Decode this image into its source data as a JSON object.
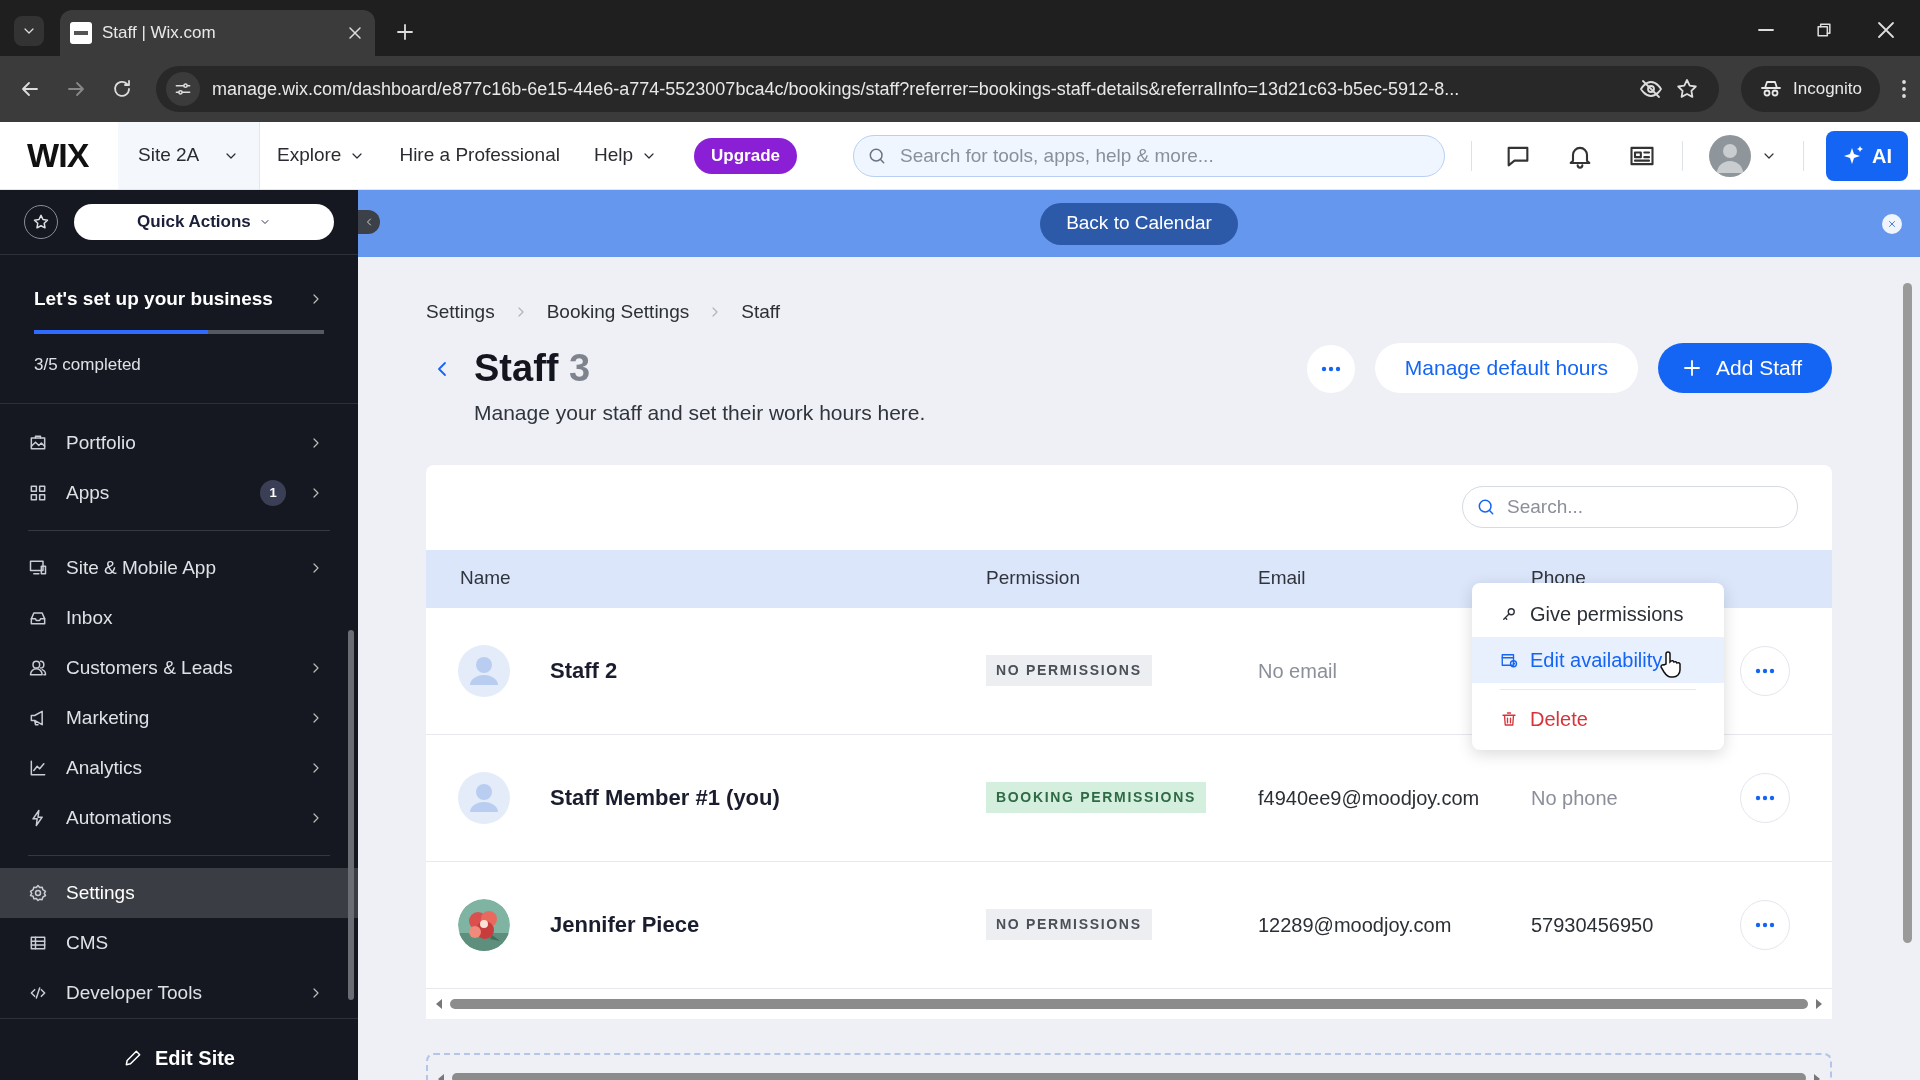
{
  "browser": {
    "tab_title": "Staff | Wix.com",
    "url": "manage.wix.com/dashboard/e877c16b-6e15-44e6-a774-5523007bca4c/bookings/staff?referrer=bookings-staff-details&referralInfo=13d21c63-b5ec-5912-8...",
    "profile": "Incognito"
  },
  "header": {
    "logo": "WIX",
    "site": "Site 2A",
    "nav": [
      {
        "label": "Explore",
        "dropdown": true
      },
      {
        "label": "Hire a Professional",
        "dropdown": false
      },
      {
        "label": "Help",
        "dropdown": true
      }
    ],
    "upgrade": "Upgrade",
    "search": {
      "placeholder": "Search for tools, apps, help & more..."
    },
    "ai": "AI"
  },
  "sidebar": {
    "quick_actions": "Quick Actions",
    "setup": {
      "title": "Let's set up your business",
      "level": 0.6,
      "progress": "3/5 completed"
    },
    "groups": [
      [
        {
          "label": "Portfolio",
          "submenu": true,
          "selected": false
        },
        {
          "label": "Apps",
          "badge": "1",
          "submenu": true,
          "selected": false
        }
      ],
      [
        {
          "label": "Site & Mobile App",
          "submenu": true,
          "selected": false
        },
        {
          "label": "Inbox",
          "submenu": false,
          "selected": false
        },
        {
          "label": "Customers & Leads",
          "submenu": true,
          "selected": false
        },
        {
          "label": "Marketing",
          "submenu": true,
          "selected": false
        },
        {
          "label": "Analytics",
          "submenu": true,
          "selected": false
        },
        {
          "label": "Automations",
          "submenu": true,
          "selected": false
        }
      ],
      [
        {
          "label": "Settings",
          "submenu": false,
          "selected": true
        },
        {
          "label": "CMS",
          "submenu": false,
          "selected": false
        },
        {
          "label": "Developer Tools",
          "submenu": true,
          "selected": false
        }
      ]
    ],
    "edit_site": "Edit Site"
  },
  "banner": {
    "button": "Back to Calendar"
  },
  "breadcrumbs": [
    "Settings",
    "Booking Settings",
    "Staff"
  ],
  "page": {
    "title": "Staff",
    "count": "3",
    "subtitle": "Manage your staff and set their work hours here.",
    "secondary_button": "Manage default hours",
    "primary_button": "Add Staff"
  },
  "table": {
    "search": {
      "placeholder": "Search..."
    },
    "columns": [
      "Name",
      "Permission",
      "Email",
      "Phone"
    ],
    "rows": [
      {
        "name": "Staff 2",
        "avatar": {
          "kind": "placeholder"
        },
        "permission": {
          "label": "NO PERMISSIONS",
          "kind": "none"
        },
        "email": {
          "text": "No email",
          "missing": true
        }
      },
      {
        "name": "Staff Member #1 (you)",
        "avatar": {
          "kind": "placeholder"
        },
        "permission": {
          "label": "BOOKING PERMISSIONS",
          "kind": "booking"
        },
        "email": {
          "text": "f4940ee9@moodjoy.com",
          "missing": false
        },
        "phone": {
          "text": "No phone",
          "missing": true
        }
      },
      {
        "name": "Jennifer Piece",
        "permission": {
          "label": "NO PERMISSIONS",
          "kind": "none"
        },
        "email": {
          "text": "12289@moodjoy.com",
          "missing": false
        },
        "phone": {
          "text": "57930456950",
          "missing": false
        }
      }
    ]
  },
  "menu": {
    "items": [
      {
        "label": "Give permissions",
        "kind": "normal",
        "selected": false
      },
      {
        "label": "Edit availability",
        "kind": "normal",
        "selected": true
      },
      {
        "label": "Delete",
        "kind": "danger",
        "selected": false
      }
    ]
  }
}
